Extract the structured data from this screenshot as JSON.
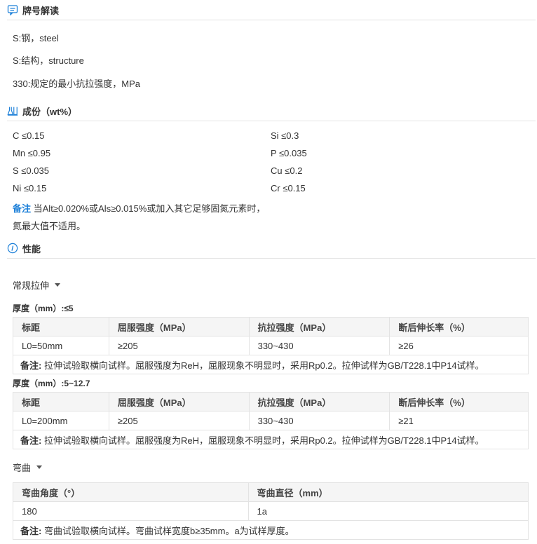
{
  "grade_section": {
    "title": "牌号解读",
    "lines": [
      "S:钢，steel",
      "S:结构，structure",
      "330:规定的最小抗拉强度，MPa"
    ]
  },
  "composition": {
    "title": "成份（wt%）",
    "left": [
      "C ≤0.15",
      "Mn ≤0.95",
      "S ≤0.035",
      "Ni ≤0.15"
    ],
    "right": [
      "Si ≤0.3",
      "P ≤0.035",
      "Cu ≤0.2",
      "Cr ≤0.15"
    ],
    "note_label": "备注",
    "note_line1": "当Alt≥0.020%或Als≥0.015%或加入其它足够固氮元素时，",
    "note_line2": "氮最大值不适用。"
  },
  "performance": {
    "title": "性能",
    "tensile_dropdown": "常规拉伸",
    "table1": {
      "heading": "厚度（mm）:≤5",
      "headers": [
        "标距",
        "屈服强度（MPa）",
        "抗拉强度（MPa）",
        "断后伸长率（%）"
      ],
      "row": [
        "L0=50mm",
        "≥205",
        "330~430",
        "≥26"
      ],
      "note_label": "备注:",
      "note": "拉伸试验取横向试样。屈服强度为ReH，屈服现象不明显时，采用Rp0.2。拉伸试样为GB/T228.1中P14试样。"
    },
    "table2": {
      "heading": "厚度（mm）:5~12.7",
      "headers": [
        "标距",
        "屈服强度（MPa）",
        "抗拉强度（MPa）",
        "断后伸长率（%）"
      ],
      "row": [
        "L0=200mm",
        "≥205",
        "330~430",
        "≥21"
      ],
      "note_label": "备注:",
      "note": "拉伸试验取横向试样。屈服强度为ReH，屈服现象不明显时，采用Rp0.2。拉伸试样为GB/T228.1中P14试样。"
    },
    "bend_dropdown": "弯曲",
    "table3": {
      "headers": [
        "弯曲角度（°）",
        "弯曲直径（mm）"
      ],
      "row": [
        "180",
        "1a"
      ],
      "note_label": "备注:",
      "note": "弯曲试验取横向试样。弯曲试样宽度b≥35mm。a为试样厚度。"
    }
  },
  "colors": {
    "accent": "#1b7fd8",
    "border": "#e3e3e3",
    "header_bg": "#f5f5f5"
  },
  "icons": [
    "message-icon",
    "flask-icon",
    "info-icon",
    "caret-down-icon"
  ]
}
